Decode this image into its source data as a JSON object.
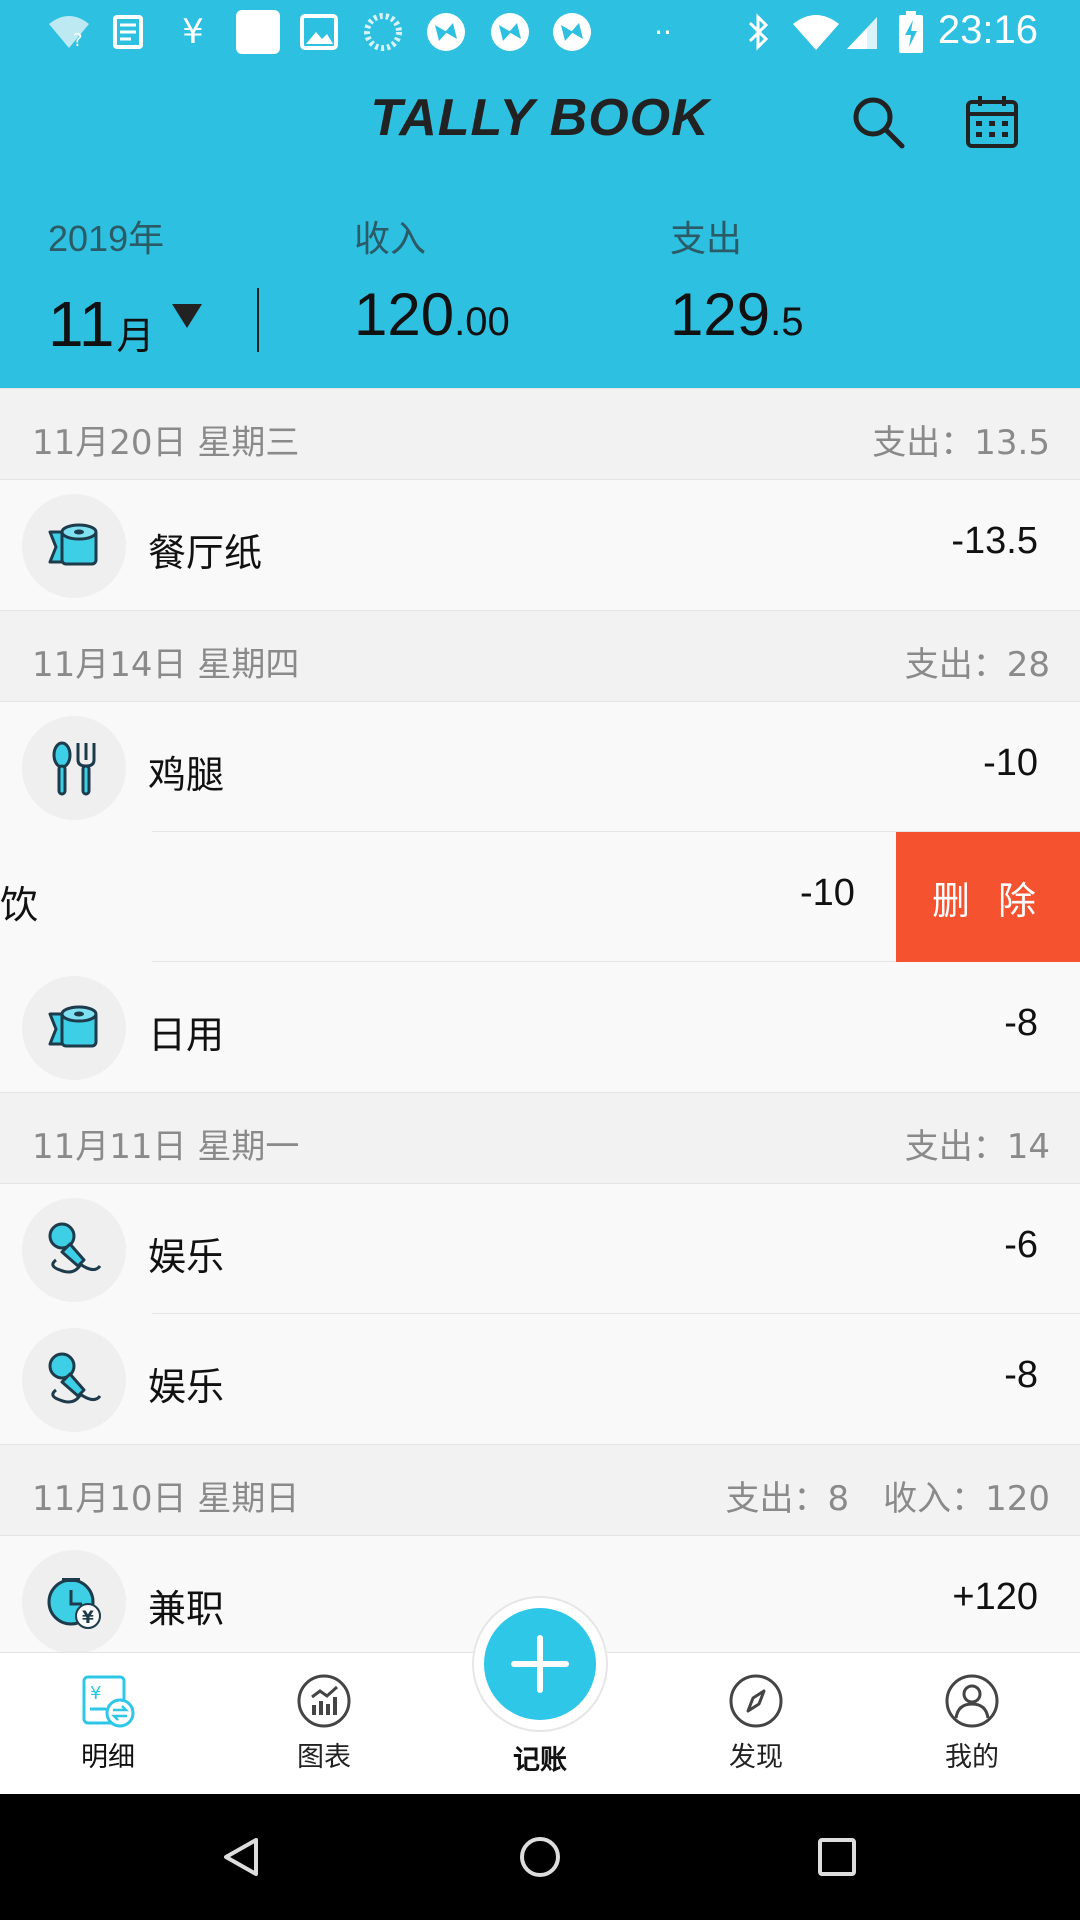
{
  "status_bar": {
    "time": "23:16",
    "left_icons": [
      "wifi-question-icon",
      "news-icon",
      "yen-icon",
      "square-icon",
      "image-icon",
      "loading-icon",
      "app-icon",
      "app-icon",
      "app-icon",
      "more-dots-icon"
    ],
    "right_icons": [
      "bluetooth-icon",
      "wifi-icon",
      "signal-icon",
      "battery-charging-icon"
    ]
  },
  "header": {
    "title": "TALLY BOOK",
    "search_icon": "search-icon",
    "calendar_icon": "calendar-icon"
  },
  "summary": {
    "year": "2019年",
    "month_value": "11",
    "month_unit": "月",
    "income_label": "收入",
    "income_int": "120",
    "income_dec": ".00",
    "expense_label": "支出",
    "expense_int": "129",
    "expense_dec": ".5"
  },
  "groups": [
    {
      "date": "11月20日  星期三",
      "totals": [
        "支出：13.5"
      ],
      "items": [
        {
          "name": "餐厅纸",
          "amount": "-13.5",
          "icon": "tissue-roll-icon"
        }
      ]
    },
    {
      "date": "11月14日  星期四",
      "totals": [
        "支出：28"
      ],
      "items": [
        {
          "name": "鸡腿",
          "amount": "-10",
          "icon": "spoon-fork-icon"
        },
        {
          "name": "饮",
          "amount": "-10",
          "swiped": true,
          "delete_label": "删 除"
        },
        {
          "name": "日用",
          "amount": "-8",
          "icon": "tissue-roll-icon"
        }
      ]
    },
    {
      "date": "11月11日  星期一",
      "totals": [
        "支出：14"
      ],
      "items": [
        {
          "name": "娱乐",
          "amount": "-6",
          "icon": "microphone-icon"
        },
        {
          "name": "娱乐",
          "amount": "-8",
          "icon": "microphone-icon"
        }
      ]
    },
    {
      "date": "11月10日  星期日",
      "totals": [
        "支出：8",
        "收入：120"
      ],
      "items": [
        {
          "name": "兼职",
          "amount": "+120",
          "icon": "clock-yen-icon"
        }
      ]
    }
  ],
  "bottom_nav": {
    "items": [
      {
        "label": "明细",
        "icon": "detail-icon",
        "active": true
      },
      {
        "label": "图表",
        "icon": "chart-icon"
      },
      {
        "label": "记账",
        "icon": "plus-icon"
      },
      {
        "label": "发现",
        "icon": "compass-icon"
      },
      {
        "label": "我的",
        "icon": "profile-icon"
      }
    ]
  },
  "colors": {
    "primary": "#2ec0e0",
    "fab": "#2ec7e8",
    "delete": "#f5522f",
    "icon_fill": "#3ccfe6"
  }
}
